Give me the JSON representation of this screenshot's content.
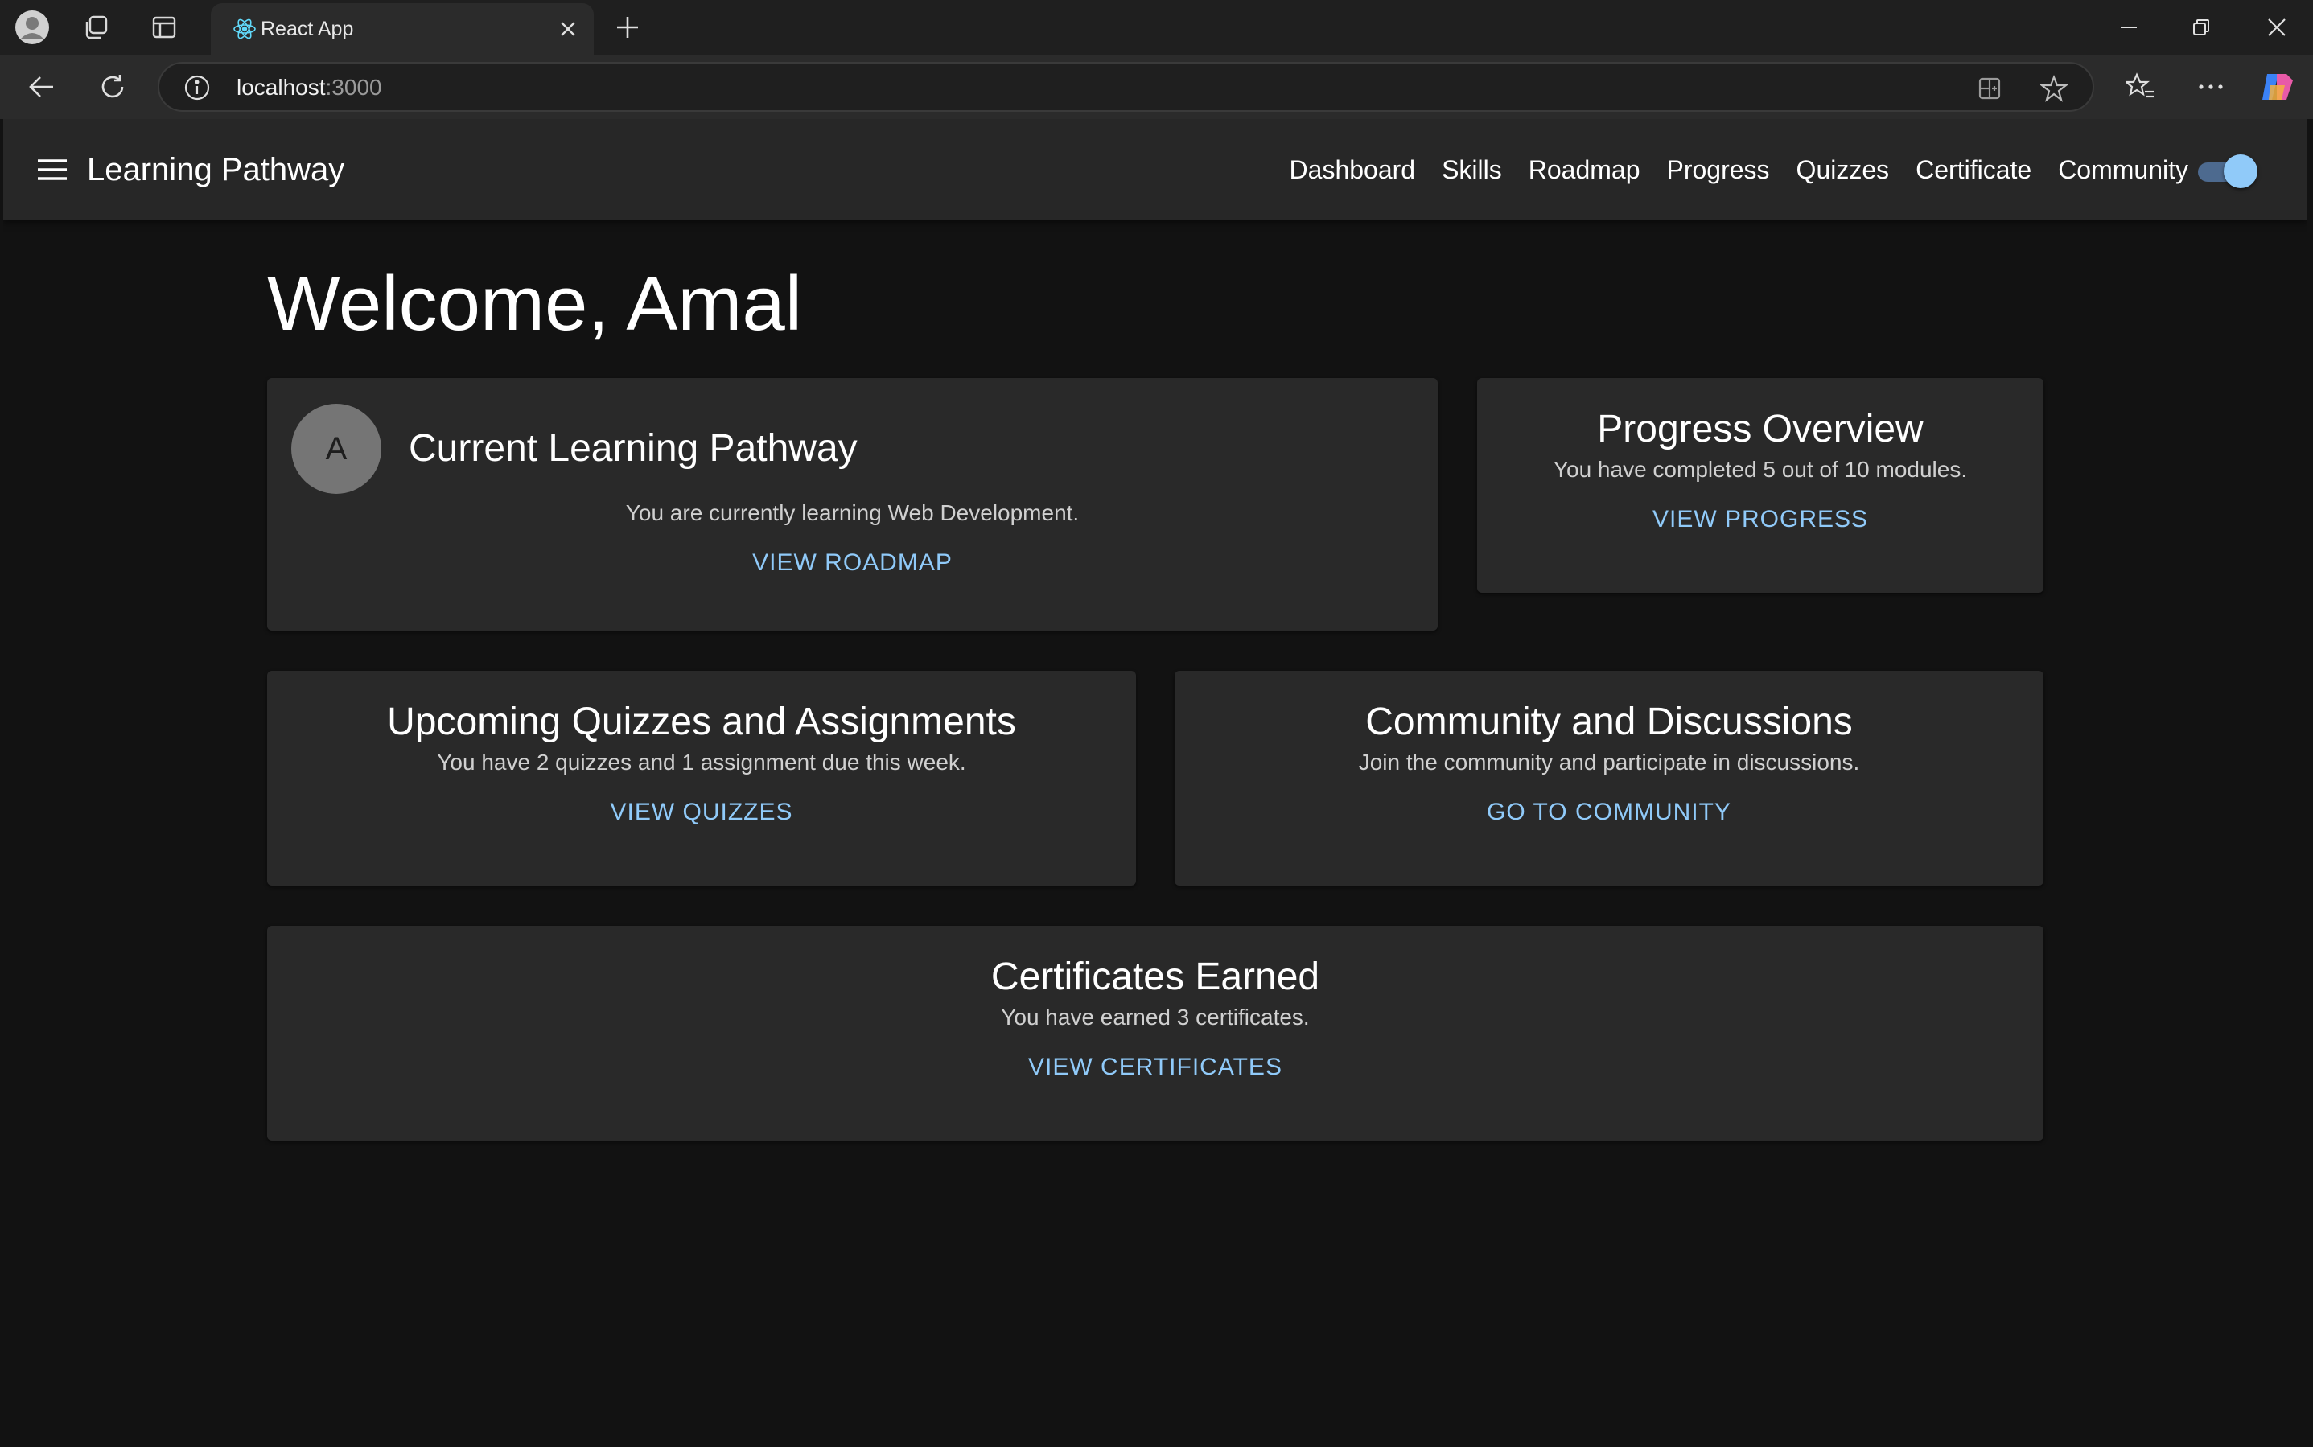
{
  "browser": {
    "tab_title": "React App",
    "url_host": "localhost",
    "url_port": ":3000"
  },
  "app": {
    "brand": "Learning Pathway",
    "nav": [
      "Dashboard",
      "Skills",
      "Roadmap",
      "Progress",
      "Quizzes",
      "Certificate",
      "Community"
    ],
    "theme_toggle_on": true,
    "accent_color": "#90caf9"
  },
  "welcome": "Welcome, Amal",
  "cards": {
    "pathway": {
      "avatar": "A",
      "title": "Current Learning Pathway",
      "text": "You are currently learning Web Development.",
      "link": "VIEW ROADMAP"
    },
    "progress": {
      "title": "Progress Overview",
      "text": "You have completed 5 out of 10 modules.",
      "link": "VIEW PROGRESS"
    },
    "quizzes": {
      "title": "Upcoming Quizzes and Assignments",
      "text": "You have 2 quizzes and 1 assignment due this week.",
      "link": "VIEW QUIZZES"
    },
    "community": {
      "title": "Community and Discussions",
      "text": "Join the community and participate in discussions.",
      "link": "GO TO COMMUNITY"
    },
    "certificates": {
      "title": "Certificates Earned",
      "text": "You have earned 3 certificates.",
      "link": "VIEW CERTIFICATES"
    }
  }
}
